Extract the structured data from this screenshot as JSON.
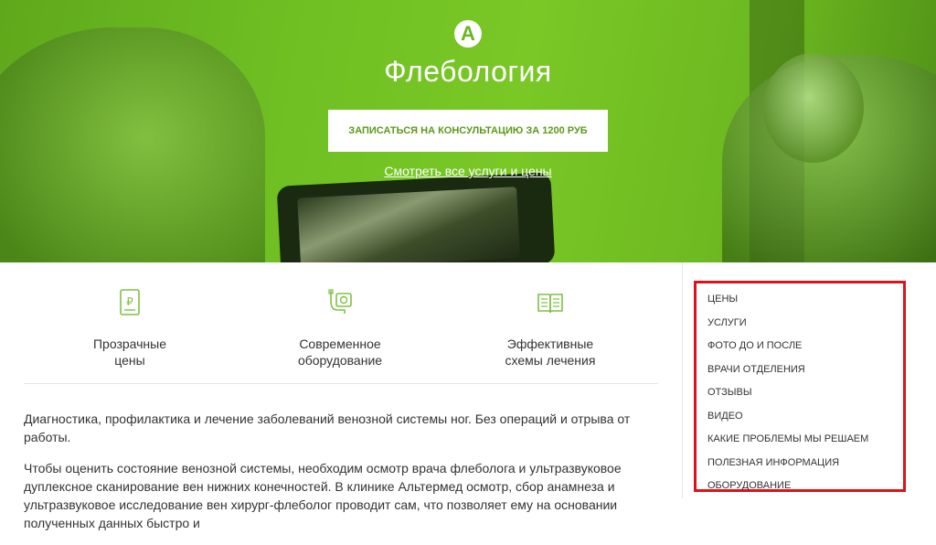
{
  "hero": {
    "logo_letter": "A",
    "title": "Флебология",
    "cta_label": "ЗАПИСАТЬСЯ НА КОНСУЛЬТАЦИЮ ЗА 1200 РУБ",
    "services_link": "Смотреть все услуги и цены"
  },
  "features": [
    {
      "icon": "price-document-icon",
      "label_line1": "Прозрачные",
      "label_line2": "цены"
    },
    {
      "icon": "medical-equipment-icon",
      "label_line1": "Современное",
      "label_line2": "оборудование"
    },
    {
      "icon": "open-book-icon",
      "label_line1": "Эффективные",
      "label_line2": "схемы лечения"
    }
  ],
  "content": {
    "paragraph1": "Диагностика, профилактика и лечение заболеваний венозной системы ног. Без операций и отрыва от работы.",
    "paragraph2": "Чтобы оценить состояние венозной системы, необходим осмотр врача флеболога и ультразвуковое дуплексное сканирование вен нижних конечностей. В клинике Альтермед осмотр, сбор анамнеза и ультразвуковое исследование вен хирург-флеболог проводит сам, что позволяет ему на основании полученных данных быстро и"
  },
  "sidebar": {
    "items": [
      "ЦЕНЫ",
      "УСЛУГИ",
      "ФОТО ДО И ПОСЛЕ",
      "ВРАЧИ ОТДЕЛЕНИЯ",
      "ОТЗЫВЫ",
      "ВИДЕО",
      "КАКИЕ ПРОБЛЕМЫ МЫ РЕШАЕМ",
      "ПОЛЕЗНАЯ ИНФОРМАЦИЯ",
      "ОБОРУДОВАНИЕ"
    ]
  },
  "colors": {
    "brand_green": "#6bb521",
    "highlight_border": "#d9141c"
  }
}
